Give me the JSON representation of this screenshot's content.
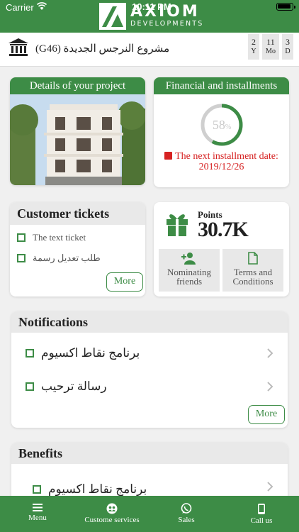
{
  "status": {
    "carrier": "Carrier",
    "time": "10:11 PM"
  },
  "brand": {
    "name": "AXIOM",
    "sub": "DEVELOPMENTS"
  },
  "project": {
    "name": "(G46) مشروع النرجس الجديدة",
    "durations": [
      {
        "value": "2",
        "unit": "Y"
      },
      {
        "value": "11",
        "unit": "Mo"
      },
      {
        "value": "3",
        "unit": "D"
      }
    ]
  },
  "details_card": {
    "title": "Details of your project"
  },
  "financial_card": {
    "title": "Financial and installments",
    "percent": 58,
    "percent_label": "58",
    "percent_unit": "%",
    "next_label": "The next installment date:",
    "next_date": "2019/12/26"
  },
  "tickets": {
    "title": "Customer tickets",
    "items": [
      "The text ticket",
      "طلب تعديل رسمة"
    ],
    "more": "More"
  },
  "points": {
    "label": "Points",
    "value": "30.7K",
    "tiles": [
      {
        "label": "Nominating friends",
        "icon": "add-person-icon"
      },
      {
        "label": "Terms and Conditions",
        "icon": "document-icon"
      }
    ]
  },
  "notifications": {
    "title": "Notifications",
    "items": [
      "برنامج نقاط اكسيوم",
      "رسالة ترحيب"
    ],
    "more": "More"
  },
  "benefits": {
    "title": "Benefits",
    "items": [
      "برنامج نقاط اكسيوم"
    ]
  },
  "nav": [
    {
      "label": "Menu",
      "icon": "menu-icon"
    },
    {
      "label": "Custome services",
      "icon": "support-icon"
    },
    {
      "label": "Sales",
      "icon": "whatsapp-icon"
    },
    {
      "label": "Call us",
      "icon": "phone-icon"
    }
  ],
  "colors": {
    "brand_green": "#3d8c46",
    "alert_red": "#d62222"
  }
}
